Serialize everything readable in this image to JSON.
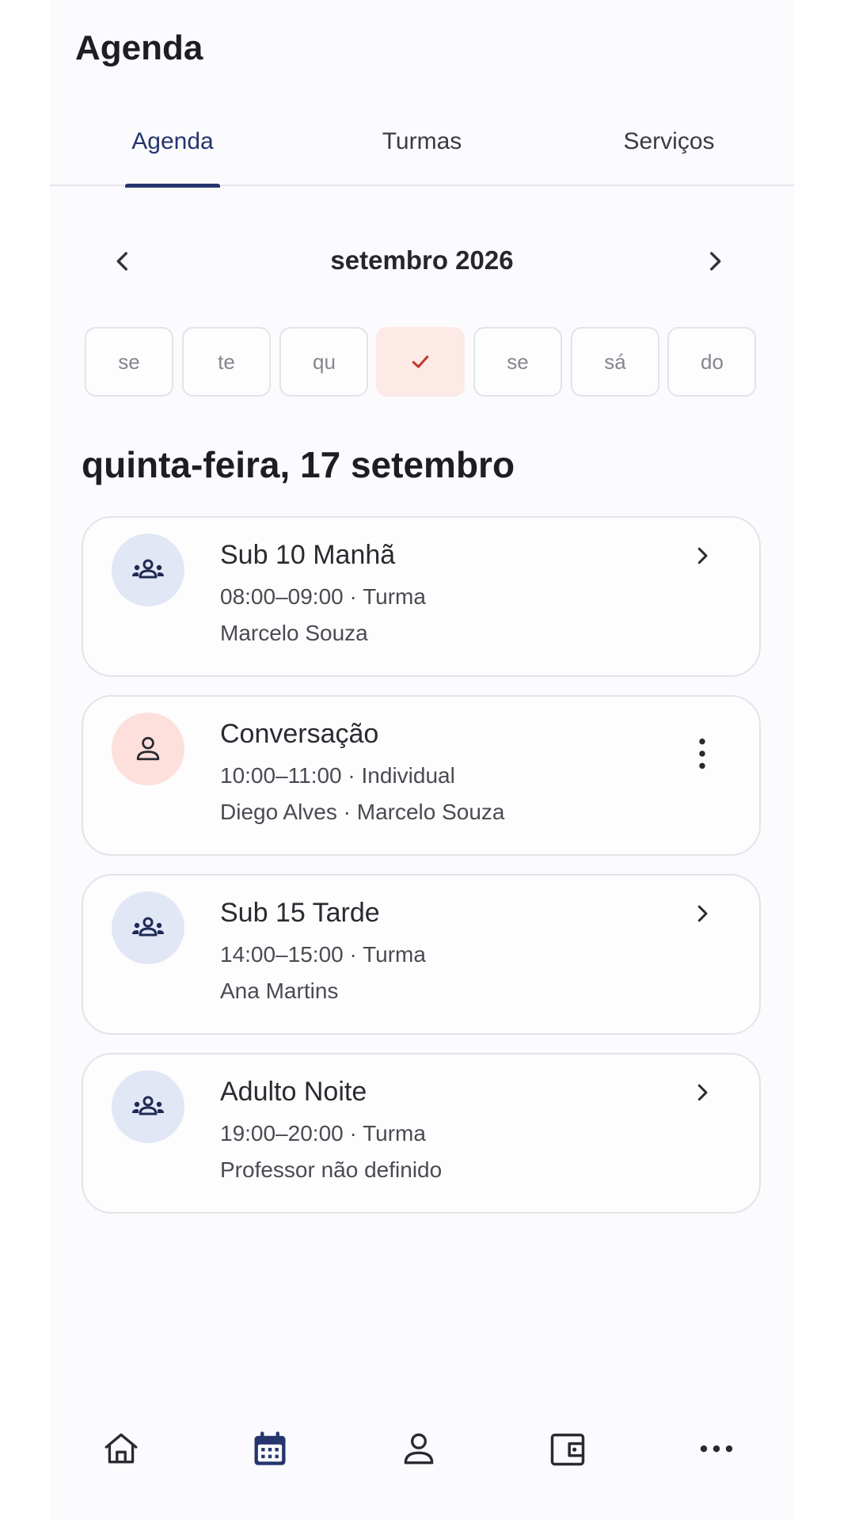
{
  "page": {
    "title": "Agenda"
  },
  "tabs": [
    {
      "label": "Agenda",
      "active": true
    },
    {
      "label": "Turmas",
      "active": false
    },
    {
      "label": "Serviços",
      "active": false
    }
  ],
  "month_nav": {
    "label": "setembro 2026",
    "prev_icon": "chevron-left-icon",
    "next_icon": "chevron-right-icon"
  },
  "days": [
    {
      "label": "se"
    },
    {
      "label": "te"
    },
    {
      "label": "qu"
    },
    {
      "label": "",
      "selected": true,
      "icon": "check-icon"
    },
    {
      "label": "se"
    },
    {
      "label": "sá"
    },
    {
      "label": "do"
    }
  ],
  "day_heading": "quinta-feira, 17 setembro",
  "sessions": [
    {
      "title": "Sub 10 Manhã",
      "line1": "08:00–09:00 · Turma",
      "line2": "Marcelo Souza",
      "kind": "group",
      "action": "chevron-right-icon"
    },
    {
      "title": "Conversação",
      "line1": "10:00–11:00 · Individual",
      "line2": "Diego Alves · Marcelo Souza",
      "kind": "person",
      "action": "more-vertical-icon"
    },
    {
      "title": "Sub 15 Tarde",
      "line1": "14:00–15:00 · Turma",
      "line2": "Ana Martins",
      "kind": "group",
      "action": "chevron-right-icon"
    },
    {
      "title": "Adulto Noite",
      "line1": "19:00–20:00 · Turma",
      "line2": "Professor não definido",
      "kind": "group",
      "action": "chevron-right-icon"
    }
  ],
  "bottom_nav": [
    {
      "icon": "home-icon",
      "active": false
    },
    {
      "icon": "calendar-icon",
      "active": true
    },
    {
      "icon": "person-icon",
      "active": false
    },
    {
      "icon": "wallet-icon",
      "active": false
    },
    {
      "icon": "more-horizontal-icon",
      "active": false
    }
  ],
  "colors": {
    "accent": "#25356e",
    "selected_day_bg": "#fde9e6",
    "selected_day_fg": "#c0392b",
    "group_avatar_bg": "#e2e7f6",
    "person_avatar_bg": "#fde0db"
  }
}
